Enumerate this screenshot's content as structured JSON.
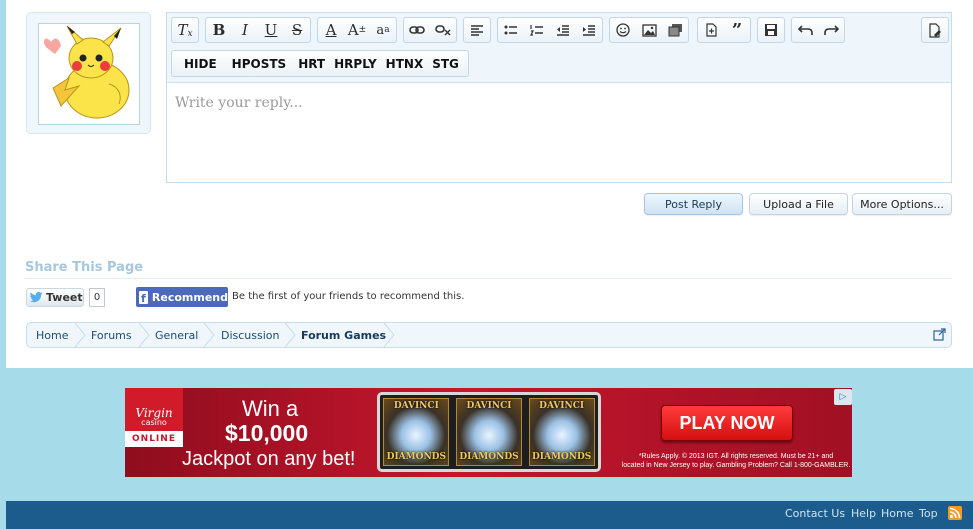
{
  "toolbar": {
    "row1_groups": [
      [
        "remove-format"
      ],
      [
        "bold",
        "italic",
        "underline",
        "strikethrough"
      ],
      [
        "text-color",
        "font-size",
        "font-family"
      ],
      [
        "link",
        "unlink"
      ],
      [
        "align-left"
      ],
      [
        "bullet-list",
        "numbered-list",
        "outdent",
        "indent"
      ],
      [
        "smilies",
        "image",
        "media"
      ],
      [
        "insert-code",
        "quote"
      ],
      [
        "save-draft"
      ],
      [
        "undo",
        "redo"
      ],
      [
        "toggle-bbcode"
      ]
    ],
    "custom_tags": [
      "HIDE",
      "HPOSTS",
      "HRT",
      "HRPLY",
      "HTNX",
      "STG"
    ]
  },
  "editor": {
    "placeholder": "Write your reply..."
  },
  "buttons": {
    "post_reply": "Post Reply",
    "upload_file": "Upload a File",
    "more_options": "More Options..."
  },
  "share": {
    "title": "Share This Page",
    "tweet_label": "Tweet",
    "tweet_count": "0",
    "recommend_label": "Recommend",
    "recommend_text": "Be the first of your friends to recommend this."
  },
  "breadcrumb": {
    "items": [
      "Home",
      "Forums",
      "General",
      "Discussion",
      "Forum Games"
    ]
  },
  "ad": {
    "brand_top": "Virgin",
    "brand_sub": "casino",
    "brand_online": "ONLINE",
    "line1": "Win a",
    "line2": "$10,000",
    "line3": "Jackpot on any bet!",
    "slot_top": "DAVINCI",
    "slot_bottom": "DIAMONDS",
    "cta": "PLAY NOW",
    "fine_print1": "*Rules Apply. © 2013 IGT. All rights reserved. Must be 21+ and",
    "fine_print2": "located in New Jersey to play. Gambling Problem? Call 1-800-GAMBLER."
  },
  "footer": {
    "links": [
      "Contact Us",
      "Help",
      "Home",
      "Top"
    ]
  },
  "colors": {
    "page_bg": "#a6dcea",
    "footer_bg": "#1b5c8c",
    "share_title": "#a7c7df",
    "facebook": "#4c69ba",
    "rss": "#f39a26"
  }
}
